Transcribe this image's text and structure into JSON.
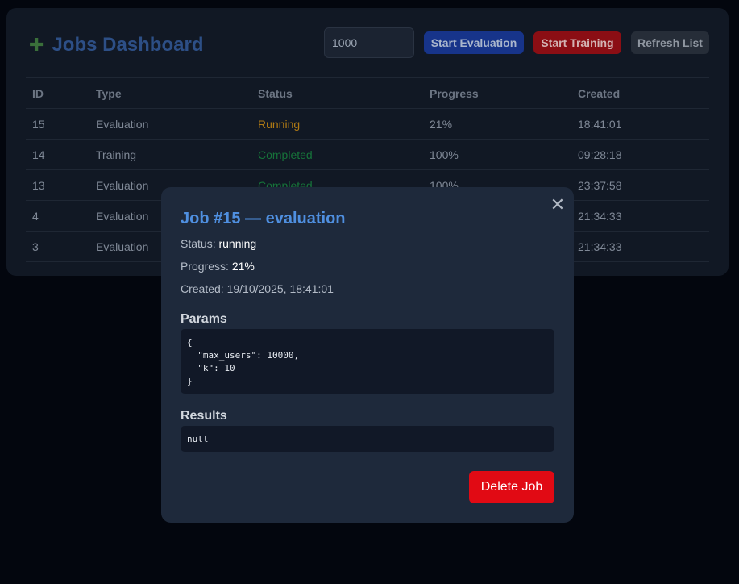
{
  "header": {
    "title": "Jobs Dashboard",
    "icon": "puzzle-icon",
    "input_value": "1000",
    "buttons": {
      "start_evaluation": "Start Evaluation",
      "start_training": "Start Training",
      "refresh": "Refresh List"
    }
  },
  "table": {
    "columns": [
      "ID",
      "Type",
      "Status",
      "Progress",
      "Created"
    ],
    "rows": [
      {
        "id": "15",
        "type": "Evaluation",
        "status": "Running",
        "status_color": "#b07a14",
        "progress": "21%",
        "created": "18:41:01"
      },
      {
        "id": "14",
        "type": "Training",
        "status": "Completed",
        "status_color": "#16733a",
        "progress": "100%",
        "created": "09:28:18"
      },
      {
        "id": "13",
        "type": "Evaluation",
        "status": "Completed",
        "status_color": "#16733a",
        "progress": "100%",
        "created": "23:37:58"
      },
      {
        "id": "4",
        "type": "Evaluation",
        "status": "",
        "status_color": "#16733a",
        "progress": "",
        "created": "21:34:33"
      },
      {
        "id": "3",
        "type": "Evaluation",
        "status": "",
        "status_color": "#16733a",
        "progress": "",
        "created": "21:34:33"
      }
    ]
  },
  "modal": {
    "title": "Job #15 — evaluation",
    "status_label": "Status:",
    "status_value": "running",
    "progress_label": "Progress:",
    "progress_value": "21%",
    "created_label": "Created:",
    "created_value": "19/10/2025, 18:41:01",
    "params_heading": "Params",
    "params_text": "{\n  \"max_users\": 10000,\n  \"k\": 10\n}",
    "results_heading": "Results",
    "results_text": "null",
    "delete_label": "Delete Job",
    "close_icon": "close-icon"
  },
  "colors": {
    "accent": "#4f8fe0",
    "danger": "#e10a14",
    "running": "#b07a14",
    "completed": "#16733a"
  }
}
